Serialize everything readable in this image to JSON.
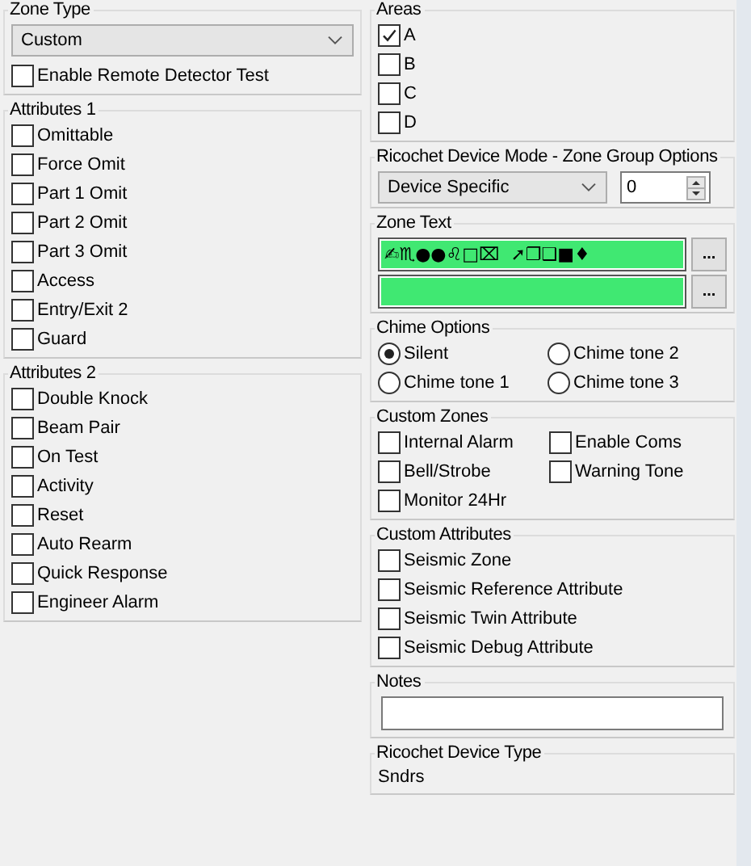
{
  "zone_type": {
    "label": "Zone Type",
    "value": "Custom",
    "remote_test": {
      "label": "Enable Remote Detector Test",
      "checked": false
    }
  },
  "attributes_1": {
    "label": "Attributes 1",
    "items": [
      {
        "label": "Omittable",
        "checked": false
      },
      {
        "label": "Force Omit",
        "checked": false
      },
      {
        "label": "Part 1 Omit",
        "checked": false
      },
      {
        "label": "Part 2 Omit",
        "checked": false
      },
      {
        "label": "Part 3 Omit",
        "checked": false
      },
      {
        "label": "Access",
        "checked": false
      },
      {
        "label": "Entry/Exit 2",
        "checked": false
      },
      {
        "label": "Guard",
        "checked": false
      }
    ]
  },
  "attributes_2": {
    "label": "Attributes 2",
    "items": [
      {
        "label": "Double Knock",
        "checked": false
      },
      {
        "label": "Beam Pair",
        "checked": false
      },
      {
        "label": "On Test",
        "checked": false
      },
      {
        "label": "Activity",
        "checked": false
      },
      {
        "label": "Reset",
        "checked": false
      },
      {
        "label": "Auto Rearm",
        "checked": false
      },
      {
        "label": "Quick Response",
        "checked": false
      },
      {
        "label": "Engineer Alarm",
        "checked": false
      }
    ]
  },
  "areas": {
    "label": "Areas",
    "items": [
      {
        "label": "A",
        "checked": true
      },
      {
        "label": "B",
        "checked": false
      },
      {
        "label": "C",
        "checked": false
      },
      {
        "label": "D",
        "checked": false
      }
    ]
  },
  "ricochet_mode": {
    "label": "Ricochet Device Mode - Zone Group Options",
    "mode": "Device Specific",
    "group": "0"
  },
  "zone_text": {
    "label": "Zone Text",
    "lines": [
      {
        "value": "✍♏●●♌□⌧  ➚❐❑■♦",
        "button": "..."
      },
      {
        "button": "..."
      }
    ]
  },
  "chime_options": {
    "label": "Chime Options",
    "items": [
      {
        "label": "Silent",
        "selected": true
      },
      {
        "label": "Chime tone 2",
        "selected": false
      },
      {
        "label": "Chime tone 1",
        "selected": false
      },
      {
        "label": "Chime tone 3",
        "selected": false
      }
    ]
  },
  "custom_zones": {
    "label": "Custom Zones",
    "items": [
      {
        "label": "Internal Alarm",
        "checked": false
      },
      {
        "label": "Enable Coms",
        "checked": false
      },
      {
        "label": "Bell/Strobe",
        "checked": false
      },
      {
        "label": "Warning Tone",
        "checked": false
      },
      {
        "label": "Monitor 24Hr",
        "checked": false
      }
    ]
  },
  "custom_attributes": {
    "label": "Custom Attributes",
    "items": [
      {
        "label": "Seismic Zone",
        "checked": false
      },
      {
        "label": "Seismic Reference Attribute",
        "checked": false
      },
      {
        "label": "Seismic Twin Attribute",
        "checked": false
      },
      {
        "label": "Seismic Debug Attribute",
        "checked": false
      }
    ]
  },
  "notes": {
    "label": "Notes"
  },
  "device_type": {
    "label": "Ricochet Device Type",
    "value": "Sndrs"
  }
}
